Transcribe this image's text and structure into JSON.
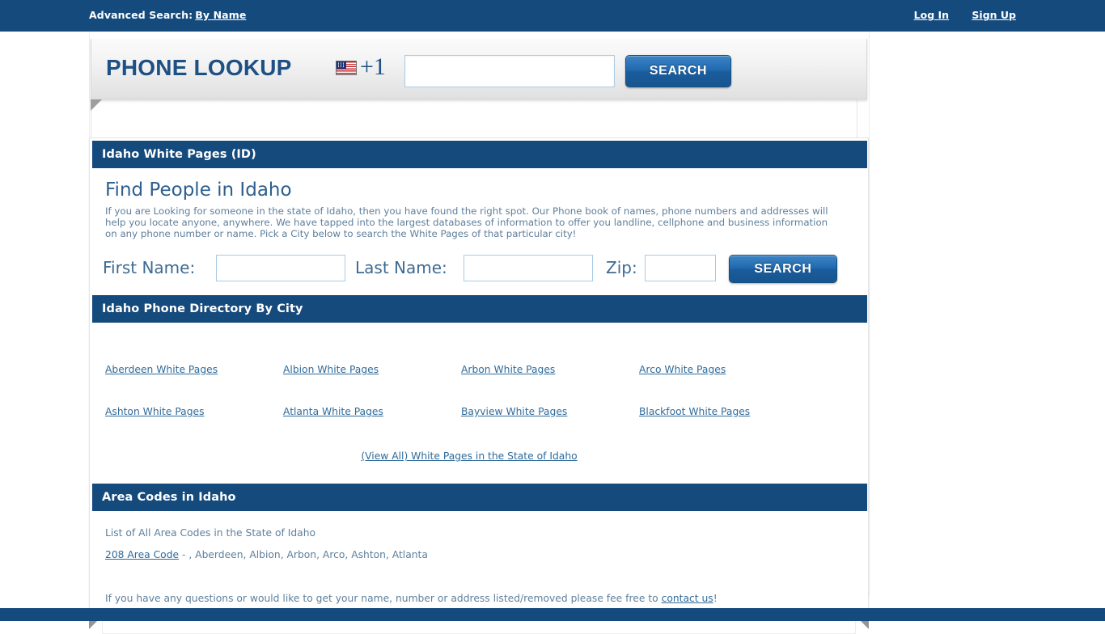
{
  "topbar": {
    "advanced_search_label": "Advanced Search:",
    "advanced_search_link": "By Name",
    "login_label": "Log In",
    "signup_label": "Sign Up"
  },
  "lookup": {
    "title": "PHONE LOOKUP",
    "flag_icon": "us-flag-icon",
    "country_code": "+1",
    "phone_value": "",
    "phone_placeholder": "",
    "search_label": "SEARCH"
  },
  "main": {
    "state_header": "Idaho White Pages (ID)",
    "page_title": "Find People in Idaho",
    "intro": "If you are Looking for someone in the state of Idaho, then you have found the right spot. Our Phone book of names, phone numbers and addresses will help you locate anyone, anywhere. We have tapped into the largest databases of information to offer you landline, cellphone and business information on any phone number or name. Pick a City below to search the White Pages of that particular city!",
    "form": {
      "first_name_label": "First Name:",
      "first_name_value": "",
      "last_name_label": "Last Name:",
      "last_name_value": "",
      "zip_label": "Zip:",
      "zip_value": "",
      "search_label": "SEARCH"
    },
    "directory_header": "Idaho Phone Directory By City",
    "cities": [
      "Aberdeen White Pages",
      "Albion White Pages",
      "Arbon White Pages",
      "Arco White Pages",
      "Ashton White Pages",
      "Atlanta White Pages",
      "Bayview White Pages",
      "Blackfoot White Pages"
    ],
    "view_all_label": "(View All) White Pages in the State of Idaho",
    "area_codes_header": "Area Codes in Idaho",
    "area_codes_intro": "List of All Area Codes in the State of Idaho",
    "area_code_link": "208 Area Code",
    "area_code_cities": " - , Aberdeen, Albion, Arbon, Arco, Ashton, Atlanta",
    "contact_prefix": "If you have any questions or would like to get your name, number or address listed/removed please fee free to ",
    "contact_link": "contact us",
    "contact_suffix": "!"
  },
  "colors": {
    "brand_blue": "#154a7c",
    "link_blue": "#2f6b9a",
    "body_text": "#5f7f9c",
    "title_blue": "#2c5f8d"
  }
}
